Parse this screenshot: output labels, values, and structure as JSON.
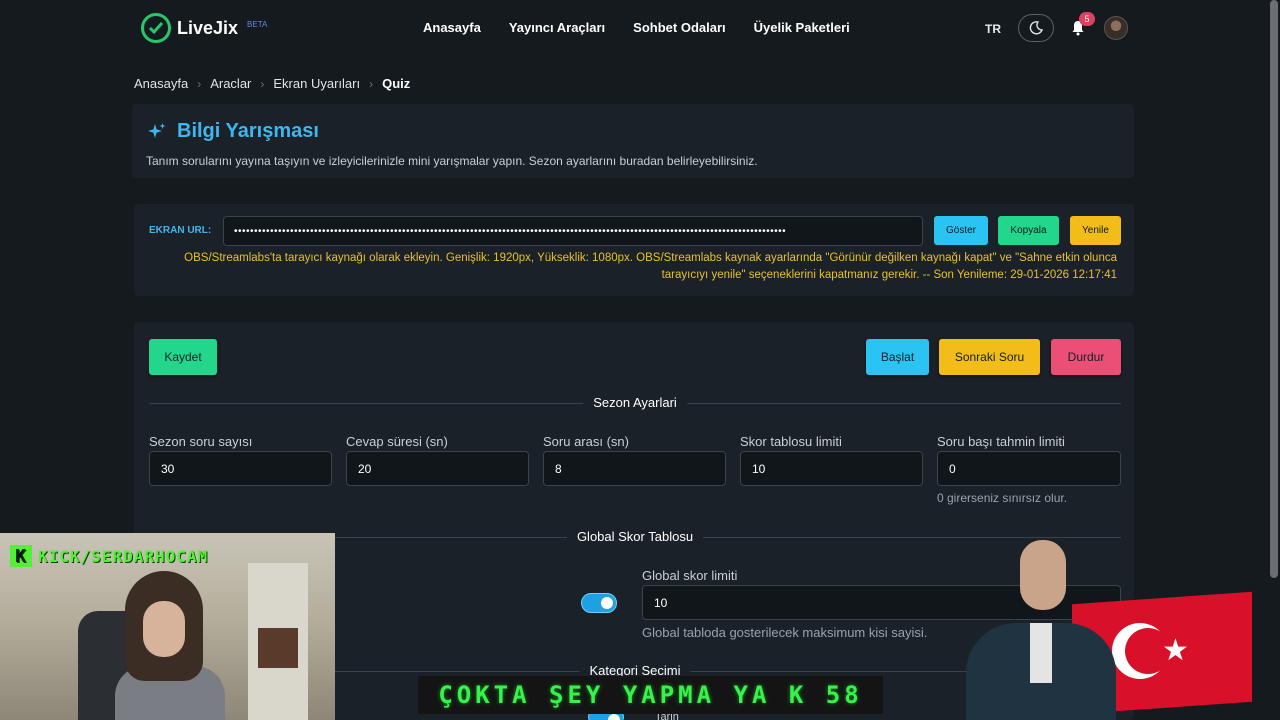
{
  "brand": {
    "name": "LiveJix",
    "badge": "BETA",
    "accent": "#25c96a"
  },
  "nav": {
    "items": [
      "Anasayfa",
      "Yayıncı Araçları",
      "Sohbet Odaları",
      "Üyelik Paketleri"
    ]
  },
  "topright": {
    "lang": "TR",
    "notification_count": "5"
  },
  "breadcrumb": {
    "items": [
      "Anasayfa",
      "Araclar",
      "Ekran Uyarıları"
    ],
    "current": "Quiz"
  },
  "header": {
    "title": "Bilgi Yarışması",
    "subtitle": "Tanım sorularını yayına taşıyın ve izleyicilerinizle mini yarışmalar yapın. Sezon ayarlarını buradan belirleyebilirsiniz."
  },
  "screen_url": {
    "label": "EKRAN URL:",
    "value": "••••••••••••••••••••••••••••••••••••••••••••••••••••••••••••••••••••••••••••••••••••••••••••••••••••••••••••••••••••••••••••••••••••••••••",
    "show_label": "Göster",
    "copy_label": "Kopyala",
    "refresh_label": "Yenile",
    "note": "OBS/Streamlabs'ta tarayıcı kaynağı olarak ekleyin. Genişlik: 1920px, Yükseklik: 1080px. OBS/Streamlabs kaynak ayarlarında \"Görünür değilken kaynağı kapat\" ve \"Sahne etkin olunca tarayıcıyı yenile\" seçeneklerini kapatmanız gerekir. -- Son Yenileme: 29-01-2026 12:17:41"
  },
  "actions": {
    "save": "Kaydet",
    "start": "Başlat",
    "next": "Sonraki Soru",
    "stop": "Durdur"
  },
  "season": {
    "title": "Sezon Ayarlari",
    "fields": [
      {
        "label": "Sezon soru sayısı",
        "value": "30"
      },
      {
        "label": "Cevap süresi (sn)",
        "value": "20"
      },
      {
        "label": "Soru arası (sn)",
        "value": "8"
      },
      {
        "label": "Skor tablosu limiti",
        "value": "10"
      },
      {
        "label": "Soru başı tahmin limiti",
        "value": "0"
      }
    ],
    "hint": "0 girerseniz sınırsız olur."
  },
  "global": {
    "title": "Global Skor Tablosu",
    "limit_label": "Global skor limiti",
    "limit_value": "10",
    "limit_hint": "Global tabloda gosterilecek maksimum kisi sayisi."
  },
  "category": {
    "title": "Kategori Secimi",
    "option": "Tarih"
  },
  "overlay": {
    "channel": "KICK/SERDARHOCAM",
    "marquee": "ÇOKTA ŞEY YAPMA YA K 58"
  },
  "colors": {
    "cyan": "#2bc3f2",
    "green": "#22d68c",
    "yellow": "#f2bd18",
    "pink": "#ec4f76",
    "title_blue": "#3fb6ef"
  }
}
